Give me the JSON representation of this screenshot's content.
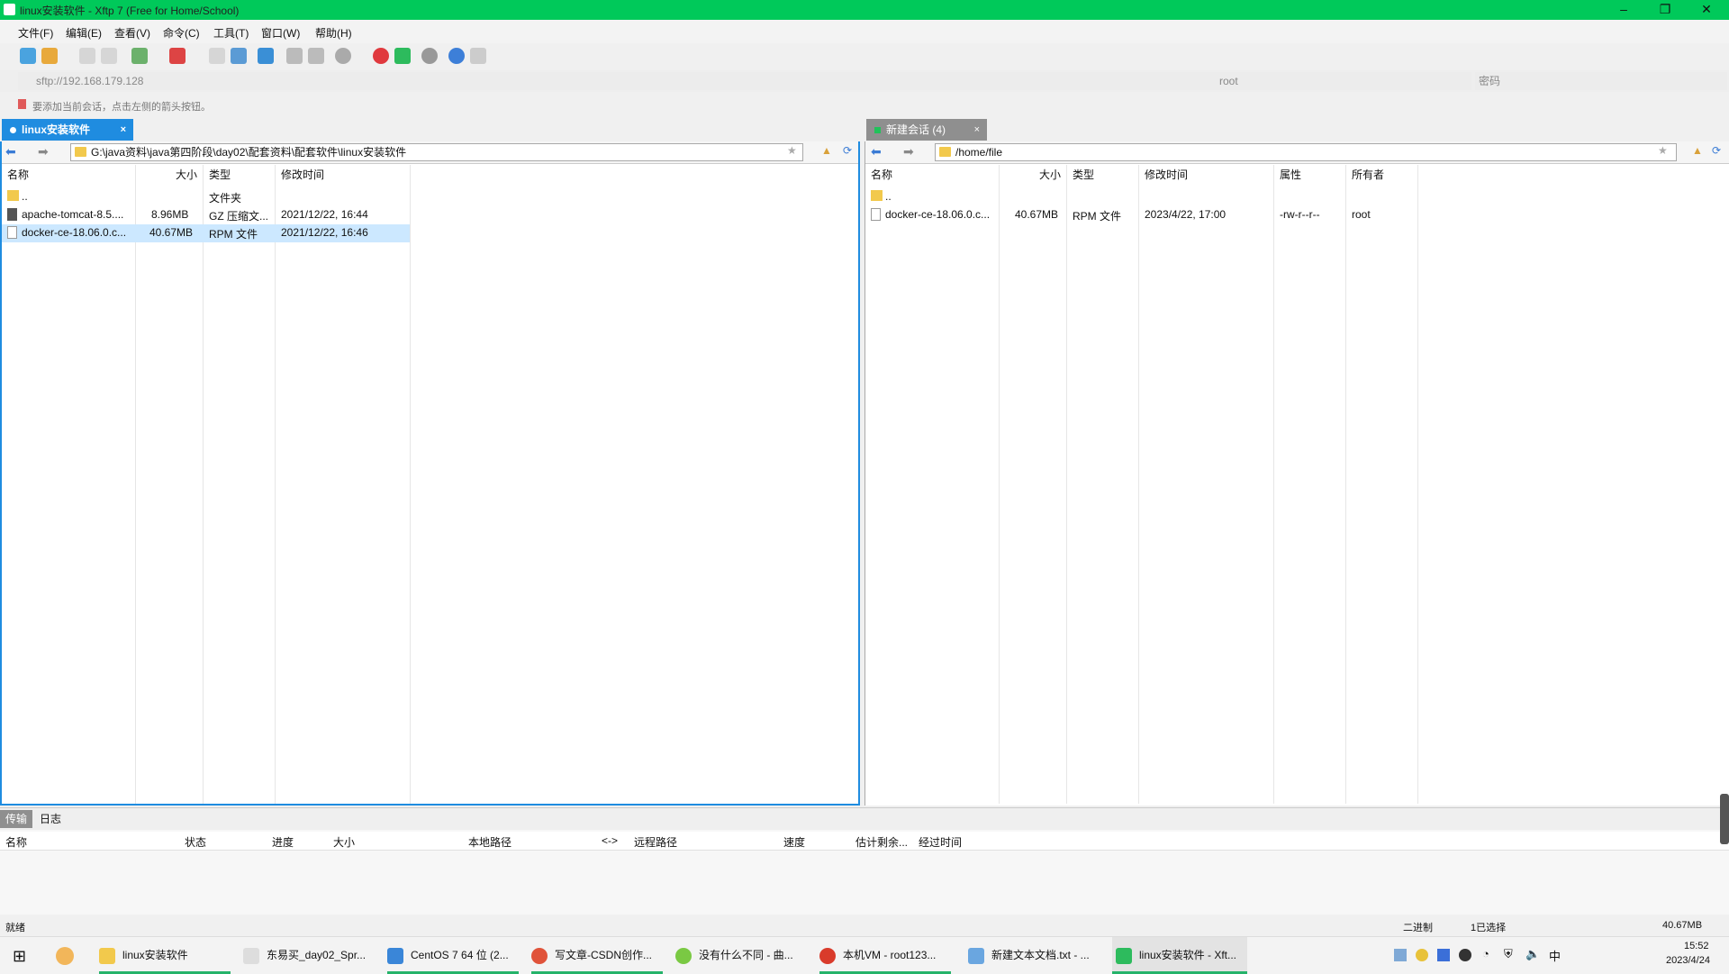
{
  "window": {
    "title": "linux安装软件 - Xftp 7 (Free for Home/School)"
  },
  "menu": [
    "文件(F)",
    "编辑(E)",
    "查看(V)",
    "命令(C)",
    "工具(T)",
    "窗口(W)",
    "帮助(H)"
  ],
  "address": {
    "url": "sftp://192.168.179.128",
    "user": "root",
    "password_placeholder": "密码"
  },
  "hint": "要添加当前会话，点击左侧的箭头按钮。",
  "left_tab": {
    "label": "linux安装软件",
    "close": "×"
  },
  "right_tab": {
    "label": "新建会话 (4)",
    "close": "×"
  },
  "left_panel": {
    "path": "G:\\java资料\\java第四阶段\\day02\\配套资料\\配套软件\\linux安装软件",
    "columns": [
      "名称",
      "大小",
      "类型",
      "修改时间"
    ],
    "rows": [
      {
        "name": "..",
        "size": "",
        "type": "文件夹",
        "mtime": ""
      },
      {
        "name": "apache-tomcat-8.5....",
        "size": "8.96MB",
        "type": "GZ 压缩文...",
        "mtime": "2021/12/22, 16:44"
      },
      {
        "name": "docker-ce-18.06.0.c...",
        "size": "40.67MB",
        "type": "RPM 文件",
        "mtime": "2021/12/22, 16:46"
      }
    ]
  },
  "right_panel": {
    "path": "/home/file",
    "columns": [
      "名称",
      "大小",
      "类型",
      "修改时间",
      "属性",
      "所有者"
    ],
    "rows": [
      {
        "name": "..",
        "size": "",
        "type": "",
        "mtime": "",
        "attr": "",
        "owner": ""
      },
      {
        "name": "docker-ce-18.06.0.c...",
        "size": "40.67MB",
        "type": "RPM 文件",
        "mtime": "2023/4/22, 17:00",
        "attr": "-rw-r--r--",
        "owner": "root"
      }
    ]
  },
  "transfer": {
    "tabs": [
      "传输",
      "日志"
    ],
    "columns": [
      "名称",
      "状态",
      "进度",
      "大小",
      "本地路径",
      "<->",
      "远程路径",
      "速度",
      "估计剩余...",
      "经过时间"
    ]
  },
  "status": {
    "left": "就绪",
    "mode": "二进制",
    "selected": "1已选择",
    "size": "40.67MB"
  },
  "taskbar": {
    "items": [
      {
        "label": "linux安装软件",
        "color": "#f2c94c"
      },
      {
        "label": "东易买_day02_Spr...",
        "color": "#dddddd"
      },
      {
        "label": "CentOS 7 64 位 (2...",
        "color": "#3a86d8"
      },
      {
        "label": "写文章-CSDN创作...",
        "color": "#e0533a"
      },
      {
        "label": "没有什么不同 - 曲...",
        "color": "#7ac943"
      },
      {
        "label": "本机VM - root123...",
        "color": "#d93b2b"
      },
      {
        "label": "新建文本文档.txt - ...",
        "color": "#6aa6e0"
      },
      {
        "label": "linux安装软件 - Xft...",
        "color": "#2dbb5d"
      }
    ],
    "clock_time": "15:52",
    "clock_date": "2023/4/24"
  }
}
